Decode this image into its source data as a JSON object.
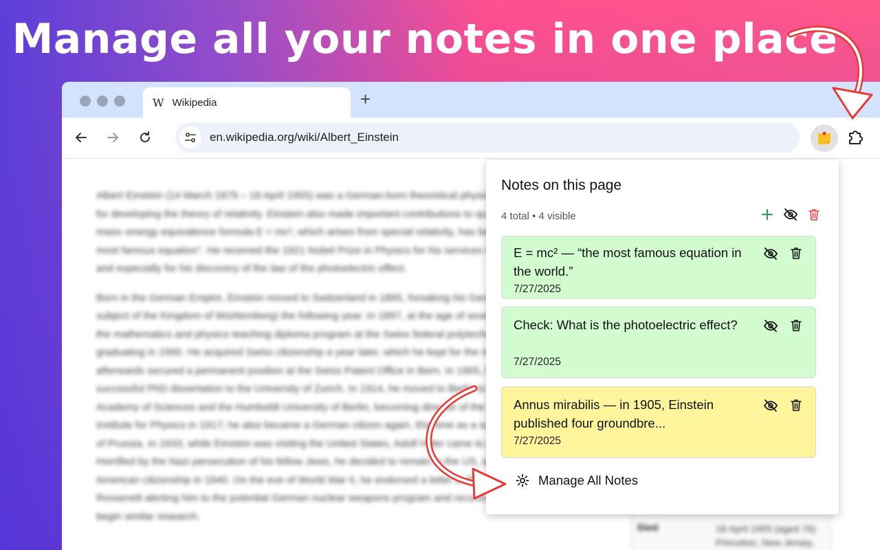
{
  "headline": "Manage all your notes in one place",
  "browser": {
    "tab_title": "Wikipedia",
    "tab_icon": "W",
    "new_tab": "+",
    "url": "en.wikipedia.org/wiki/Albert_Einstein"
  },
  "article": {
    "paragraphs": [
      "Albert Einstein (14 March 1879 – 18 April 1955) was a German-born theoretical physicist who is best known for developing the theory of relativity. Einstein also made important contributions to quantum mechanics. His mass–energy equivalence formula E = mc², which arises from special relativity, has been called \"the world's most famous equation\". He received the 1921 Nobel Prize in Physics for his services to theoretical physics, and especially for his discovery of the law of the photoelectric effect.",
      "Born in the German Empire, Einstein moved to Switzerland in 1895, forsaking his German citizenship (as a subject of the Kingdom of Württemberg) the following year. In 1897, at the age of seventeen, he enrolled in the mathematics and physics teaching diploma program at the Swiss federal polytechnic school in Zurich, graduating in 1900. He acquired Swiss citizenship a year later, which he kept for the rest of his life, and afterwards secured a permanent position at the Swiss Patent Office in Bern. In 1905, he submitted a successful PhD dissertation to the University of Zurich. In 1914, he moved to Berlin to join the Prussian Academy of Sciences and the Humboldt University of Berlin, becoming director of the Kaiser Wilhelm Institute for Physics in 1917; he also became a German citizen again, this time as a subject of the Kingdom of Prussia. In 1933, while Einstein was visiting the United States, Adolf Hitler came to power in Germany. Horrified by the Nazi persecution of his fellow Jews, he decided to remain in the US, and was granted American citizenship in 1940. On the eve of World War II, he endorsed a letter to President Franklin D. Roosevelt alerting him to the potential German nuclear weapons program and recommending that the US begin similar research."
    ],
    "infobox_label": "Died",
    "infobox_value": "18 April 1955 (aged 76) Princeton, New Jersey, U.S."
  },
  "popup": {
    "title": "Notes on this page",
    "count": "4 total • 4 visible",
    "notes": [
      {
        "text": "E = mc² — “the most famous equation in the world.”",
        "date": "7/27/2025",
        "color": "#d2fbd0"
      },
      {
        "text": "Check: What is the photoelectric effect?",
        "date": "7/27/2025",
        "color": "#d2fbd0"
      },
      {
        "text": "Annus mirabilis — in 1905, Einstein published four groundbre...",
        "date": "7/27/2025",
        "color": "#fff59d"
      }
    ],
    "manage_label": "Manage All Notes"
  },
  "colors": {
    "add": "#22a349",
    "delete_all": "#ef4444",
    "arrow": "#e53935"
  },
  "icons": [
    "back-icon",
    "forward-icon",
    "reload-icon",
    "tune-icon",
    "sticky-note-icon",
    "puzzle-icon",
    "plus-icon",
    "eye-off-icon",
    "trash-icon",
    "gear-icon"
  ]
}
